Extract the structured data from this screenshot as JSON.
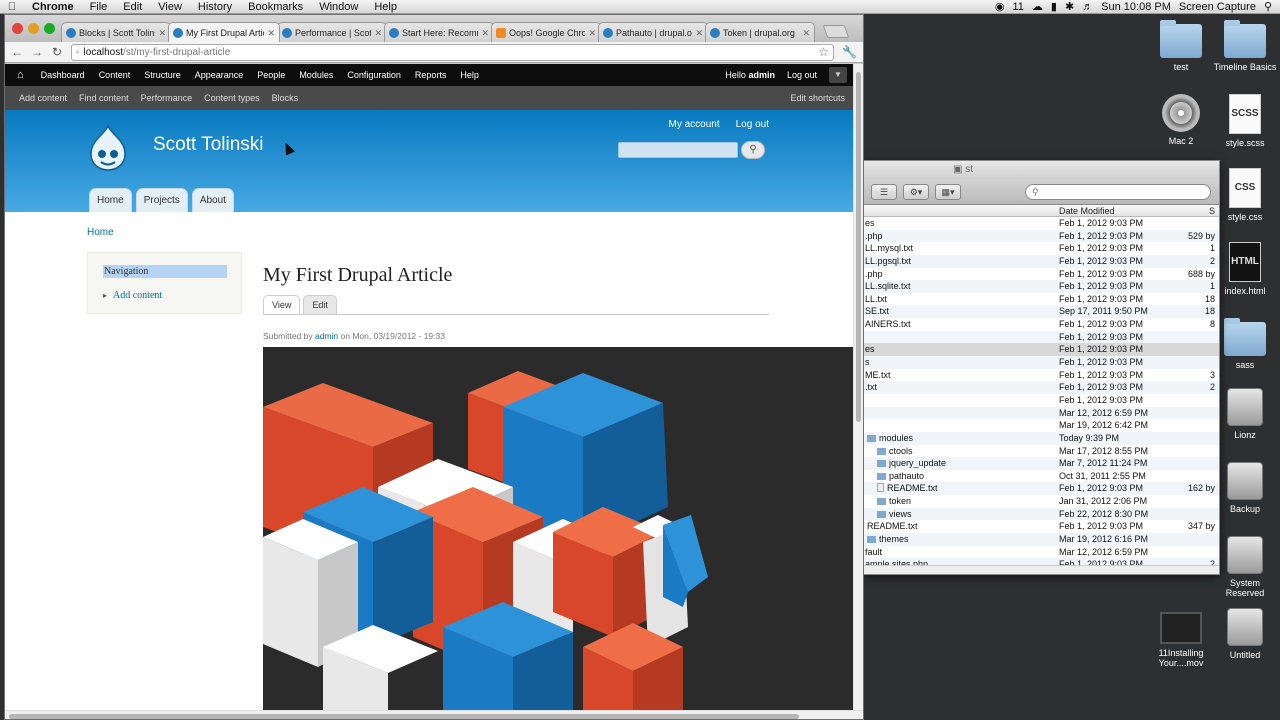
{
  "mac_menubar": {
    "app": "Chrome",
    "items": [
      "File",
      "Edit",
      "View",
      "History",
      "Bookmarks",
      "Window",
      "Help"
    ],
    "status_count": "11",
    "clock": "Sun 10:08 PM",
    "right_label": "Screen Capture"
  },
  "browser": {
    "tabs": [
      {
        "label": "Blocks | Scott Tolinski",
        "favicon": "drupal"
      },
      {
        "label": "My First Drupal Artic",
        "favicon": "drupal"
      },
      {
        "label": "Performance | Scott T",
        "favicon": "drupal"
      },
      {
        "label": "Start Here: Recomme",
        "favicon": "drupal"
      },
      {
        "label": "Oops! Google Chrom",
        "favicon": "blogger"
      },
      {
        "label": "Pathauto | drupal.org",
        "favicon": "drupal"
      },
      {
        "label": "Token | drupal.org",
        "favicon": "drupal"
      }
    ],
    "url_host": "localhost",
    "url_path": "/st/my-first-drupal-article"
  },
  "drupal": {
    "toolbar": [
      "Dashboard",
      "Content",
      "Structure",
      "Appearance",
      "People",
      "Modules",
      "Configuration",
      "Reports",
      "Help"
    ],
    "hello_prefix": "Hello",
    "user": "admin",
    "logout": "Log out",
    "shortcuts": [
      "Add content",
      "Find content",
      "Performance",
      "Content types",
      "Blocks"
    ],
    "edit_shortcuts": "Edit shortcuts",
    "site_name": "Scott Tolinski",
    "secondary_menu": [
      "My account",
      "Log out"
    ],
    "main_menu": [
      "Home",
      "Projects",
      "About"
    ],
    "breadcrumb": "Home",
    "sidebar": {
      "heading": "Navigation",
      "item": "Add content"
    },
    "article": {
      "title": "My First Drupal Article",
      "tabs": [
        "View",
        "Edit"
      ],
      "submitted_prefix": "Submitted by",
      "author": "admin",
      "submitted_suffix": "on Mon, 03/19/2012 - 19:33"
    }
  },
  "finder": {
    "title": "st",
    "columns": {
      "date": "Date Modified",
      "size": "S"
    },
    "rows": [
      {
        "name": "es",
        "date": "Feb 1, 2012 9:03 PM",
        "size": ""
      },
      {
        "name": ".php",
        "date": "Feb 1, 2012 9:03 PM",
        "size": "529 by"
      },
      {
        "name": "LL.mysql.txt",
        "date": "Feb 1, 2012 9:03 PM",
        "size": "1"
      },
      {
        "name": "LL.pgsql.txt",
        "date": "Feb 1, 2012 9:03 PM",
        "size": "2"
      },
      {
        "name": ".php",
        "date": "Feb 1, 2012 9:03 PM",
        "size": "688 by"
      },
      {
        "name": "LL.sqlite.txt",
        "date": "Feb 1, 2012 9:03 PM",
        "size": "1"
      },
      {
        "name": "LL.txt",
        "date": "Feb 1, 2012 9:03 PM",
        "size": "18"
      },
      {
        "name": "SE.txt",
        "date": "Sep 17, 2011 9:50 PM",
        "size": "18"
      },
      {
        "name": "AINERS.txt",
        "date": "Feb 1, 2012 9:03 PM",
        "size": "8"
      },
      {
        "name": "",
        "date": "Feb 1, 2012 9:03 PM",
        "size": ""
      },
      {
        "name": "es",
        "date": "Feb 1, 2012 9:03 PM",
        "size": ""
      },
      {
        "name": "s",
        "date": "Feb 1, 2012 9:03 PM",
        "size": ""
      },
      {
        "name": "ME.txt",
        "date": "Feb 1, 2012 9:03 PM",
        "size": "3"
      },
      {
        "name": ".txt",
        "date": "Feb 1, 2012 9:03 PM",
        "size": "2"
      },
      {
        "name": "",
        "date": "Feb 1, 2012 9:03 PM",
        "size": ""
      },
      {
        "name": "",
        "date": "Mar 12, 2012 6:59 PM",
        "size": ""
      },
      {
        "name": "",
        "date": "Mar 19, 2012 6:42 PM",
        "size": ""
      },
      {
        "name": "modules",
        "date": "Today 9:39 PM",
        "size": ""
      },
      {
        "name": "ctools",
        "date": "Mar 17, 2012 8:55 PM",
        "size": ""
      },
      {
        "name": "jquery_update",
        "date": "Mar 7, 2012 11:24 PM",
        "size": ""
      },
      {
        "name": "pathauto",
        "date": "Oct 31, 2011 2:55 PM",
        "size": ""
      },
      {
        "name": "README.txt",
        "date": "Feb 1, 2012 9:03 PM",
        "size": "162 by"
      },
      {
        "name": "token",
        "date": "Jan 31, 2012 2:06 PM",
        "size": ""
      },
      {
        "name": "views",
        "date": "Feb 22, 2012 8:30 PM",
        "size": ""
      },
      {
        "name": "README.txt",
        "date": "Feb 1, 2012 9:03 PM",
        "size": "347 by"
      },
      {
        "name": "themes",
        "date": "Mar 19, 2012 6:16 PM",
        "size": ""
      },
      {
        "name": "fault",
        "date": "Mar 12, 2012 6:59 PM",
        "size": ""
      },
      {
        "name": "ample.sites.php",
        "date": "Feb 1, 2012 9:03 PM",
        "size": "2"
      },
      {
        "name": "s",
        "date": "Feb 1, 2012 9:03 PM",
        "size": ""
      }
    ]
  },
  "desktop_icons": [
    {
      "label": "test",
      "kind": "folder"
    },
    {
      "label": "Timeline Basics",
      "kind": "folder"
    },
    {
      "label": "Mac 2",
      "kind": "hdd"
    },
    {
      "label": "style.scss",
      "kind": "doc",
      "glyph": "SCSS"
    },
    {
      "label": "style.css",
      "kind": "doc",
      "glyph": "CSS"
    },
    {
      "label": "index.html",
      "kind": "doc-dark",
      "glyph": "HTML"
    },
    {
      "label": "sass",
      "kind": "folder"
    },
    {
      "label": "Lionz",
      "kind": "drive"
    },
    {
      "label": "Backup",
      "kind": "drive"
    },
    {
      "label": "System Reserved",
      "kind": "drive"
    },
    {
      "label": "11Installing Your....mov",
      "kind": "movie"
    },
    {
      "label": "Untitled",
      "kind": "drive"
    }
  ],
  "colors": {
    "drupal_header_top": "#0779bf",
    "drupal_header_bottom": "#48a9e4",
    "link": "#0071b3",
    "cube_red": "#e1522a",
    "cube_blue": "#1a7ac4",
    "cube_white": "#f2f2f2"
  }
}
